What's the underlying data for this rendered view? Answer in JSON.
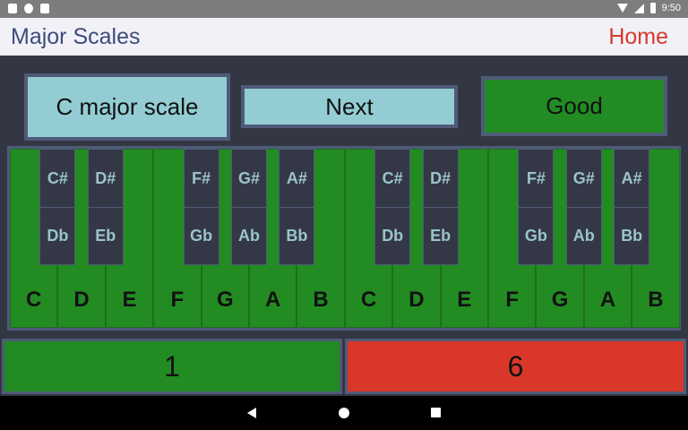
{
  "status_bar": {
    "time": "9:50",
    "left_icons": [
      "notification-a-icon",
      "circle-icon",
      "sd-card-icon"
    ],
    "right_icons": [
      "wifi-icon",
      "signal-icon",
      "battery-icon"
    ]
  },
  "app_bar": {
    "title": "Major Scales",
    "home_label": "Home"
  },
  "controls": {
    "scale_label": "C major scale",
    "next_label": "Next",
    "status_label": "Good"
  },
  "keyboard": {
    "white_keys": [
      "C",
      "D",
      "E",
      "F",
      "G",
      "A",
      "B",
      "C",
      "D",
      "E",
      "F",
      "G",
      "A",
      "B"
    ],
    "black_keys": [
      {
        "sharp": "C#",
        "flat": "Db"
      },
      {
        "sharp": "D#",
        "flat": "Eb"
      },
      {
        "sharp": "F#",
        "flat": "Gb"
      },
      {
        "sharp": "G#",
        "flat": "Ab"
      },
      {
        "sharp": "A#",
        "flat": "Bb"
      },
      {
        "sharp": "C#",
        "flat": "Db"
      },
      {
        "sharp": "D#",
        "flat": "Eb"
      },
      {
        "sharp": "F#",
        "flat": "Gb"
      },
      {
        "sharp": "G#",
        "flat": "Ab"
      },
      {
        "sharp": "A#",
        "flat": "Bb"
      }
    ]
  },
  "counters": {
    "correct": "1",
    "wrong": "6"
  },
  "colors": {
    "key_green": "#228b22",
    "wrong_red": "#d9372a",
    "button_teal": "#93cdd3",
    "background": "#333744"
  },
  "nav_bar": {
    "icons": [
      "back-icon",
      "home-icon",
      "recents-icon"
    ]
  }
}
